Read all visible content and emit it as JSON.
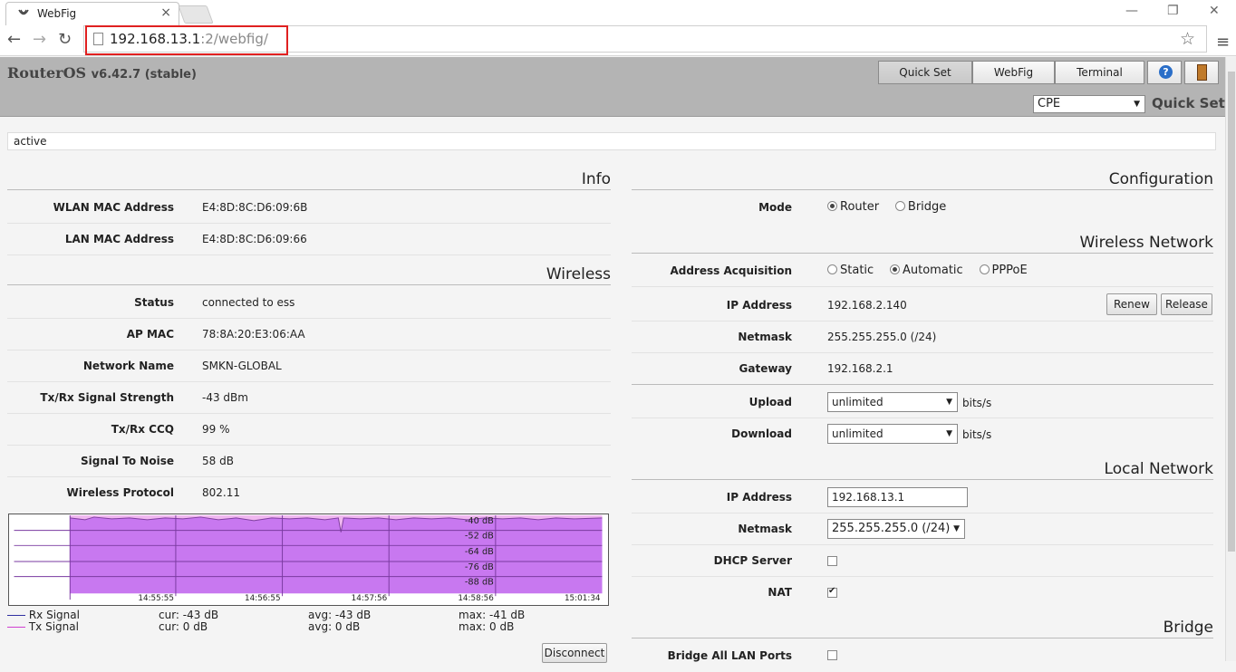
{
  "browser": {
    "tab_title": "WebFig",
    "tab_close": "×",
    "url_host": "192.168.13.1",
    "url_rest": ":2/webfig/",
    "win_min": "—",
    "win_restore": "❐",
    "win_close": "✕"
  },
  "header": {
    "brand": "RouterOS",
    "version": "v6.42.7 (stable)",
    "nav": [
      "Quick Set",
      "WebFig",
      "Terminal"
    ],
    "mode_value": "CPE",
    "page_title": "Quick Set",
    "status": "active"
  },
  "info": {
    "title": "Info",
    "rows": [
      {
        "label": "WLAN MAC Address",
        "value": "E4:8D:8C:D6:09:6B"
      },
      {
        "label": "LAN MAC Address",
        "value": "E4:8D:8C:D6:09:66"
      }
    ]
  },
  "wireless": {
    "title": "Wireless",
    "rows": [
      {
        "label": "Status",
        "value": "connected to ess"
      },
      {
        "label": "AP MAC",
        "value": "78:8A:20:E3:06:AA"
      },
      {
        "label": "Network Name",
        "value": "SMKN-GLOBAL"
      },
      {
        "label": "Tx/Rx Signal Strength",
        "value": "-43 dBm"
      },
      {
        "label": "Tx/Rx CCQ",
        "value": "99 %"
      },
      {
        "label": "Signal To Noise",
        "value": "58 dB"
      },
      {
        "label": "Wireless Protocol",
        "value": "802.11"
      }
    ],
    "disconnect": "Disconnect"
  },
  "graph": {
    "y_ticks": [
      "-40 dB",
      "-52 dB",
      "-64 dB",
      "-76 dB",
      "-88 dB"
    ],
    "x_ticks": [
      "14:55:55",
      "14:56:55",
      "14:57:56",
      "14:58:56",
      "15:01:34"
    ],
    "legend": [
      {
        "name": "Rx Signal",
        "cur": "cur: -43 dB",
        "avg": "avg: -43 dB",
        "max": "max: -41 dB",
        "color": "#3030a0"
      },
      {
        "name": "Tx Signal",
        "cur": "cur: 0 dB",
        "avg": "avg: 0 dB",
        "max": "max: 0 dB",
        "color": "#d040d0"
      }
    ]
  },
  "config": {
    "title": "Configuration",
    "mode_label": "Mode",
    "mode_options": [
      "Router",
      "Bridge"
    ]
  },
  "wireless_network": {
    "title": "Wireless Network",
    "acq_label": "Address Acquisition",
    "acq_options": [
      "Static",
      "Automatic",
      "PPPoE"
    ],
    "ip_label": "IP Address",
    "ip_value": "192.168.2.140",
    "renew": "Renew",
    "release": "Release",
    "netmask_label": "Netmask",
    "netmask_value": "255.255.255.0 (/24)",
    "gateway_label": "Gateway",
    "gateway_value": "192.168.2.1",
    "upload_label": "Upload",
    "upload_value": "unlimited",
    "download_label": "Download",
    "download_value": "unlimited",
    "unit": "bits/s"
  },
  "local_network": {
    "title": "Local Network",
    "ip_label": "IP Address",
    "ip_value": "192.168.13.1",
    "netmask_label": "Netmask",
    "netmask_value": "255.255.255.0 (/24)",
    "dhcp_label": "DHCP Server",
    "nat_label": "NAT"
  },
  "bridge": {
    "title": "Bridge",
    "all_lan_label": "Bridge All LAN Ports"
  }
}
